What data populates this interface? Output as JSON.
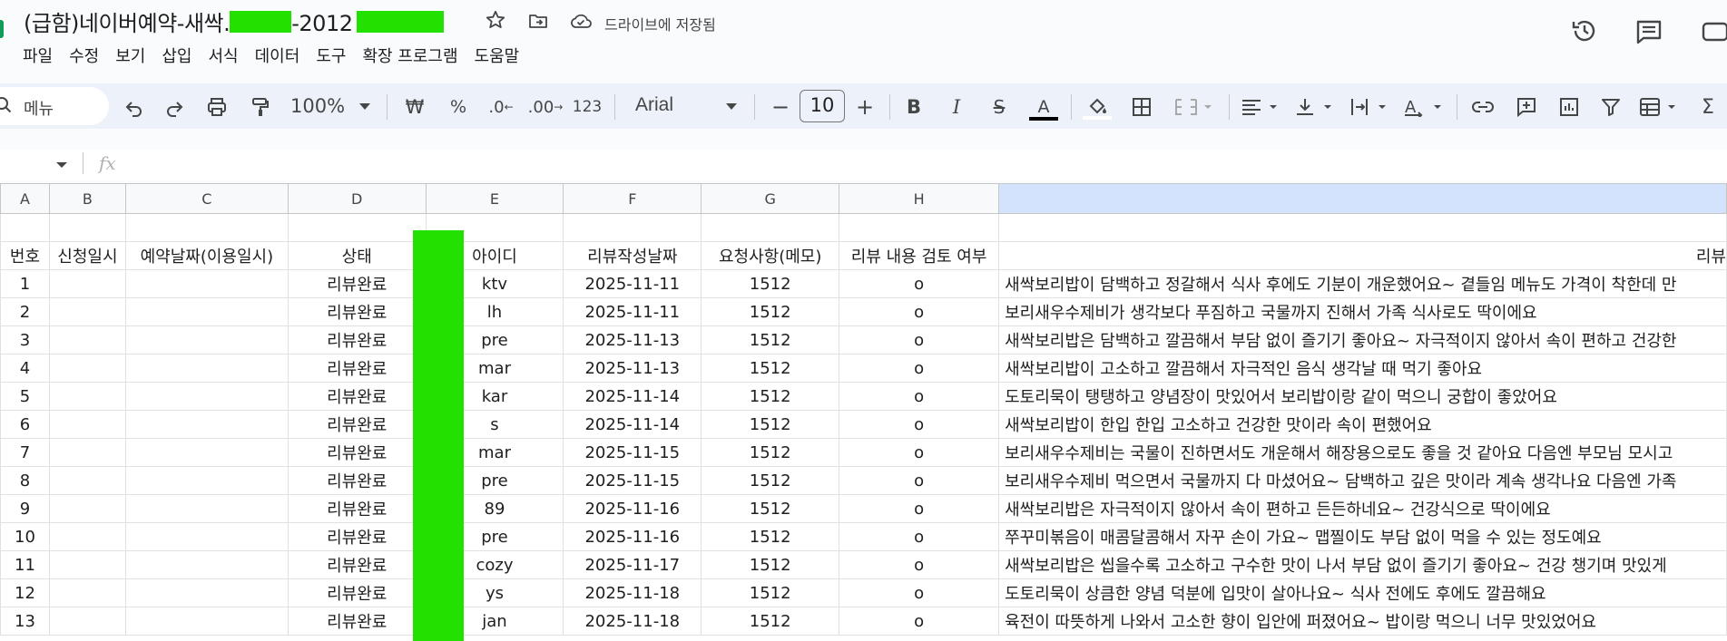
{
  "title": {
    "doc_title": "(급함)네이버예약-새싹.",
    "doc_title_suffix": "-2012",
    "save_status": "드라이브에 저장됨"
  },
  "menu": [
    "파일",
    "수정",
    "보기",
    "삽입",
    "서식",
    "데이터",
    "도구",
    "확장 프로그램",
    "도움말"
  ],
  "toolbar": {
    "search_label": "메뉴",
    "zoom": "100%",
    "currency": "₩",
    "percent": "%",
    "number_format": "123",
    "font": "Arial",
    "font_size": "10"
  },
  "formula_bar": {
    "fx": "fx"
  },
  "columns": [
    "A",
    "B",
    "C",
    "D",
    "E",
    "F",
    "G",
    "H",
    ""
  ],
  "header_row": [
    "번호",
    "신청일시",
    "예약날짜(이용일시)",
    "상태",
    "아이디",
    "리뷰작성날짜",
    "요청사항(메모)",
    "리뷰 내용 검토 여부",
    "리뷰"
  ],
  "rows": [
    {
      "no": "1",
      "status": "리뷰완료",
      "id": "ktv",
      "date": "2025-11-11",
      "memo": "1512",
      "check": "o",
      "review": "새싹보리밥이 담백하고 정갈해서 식사 후에도 기분이 개운했어요~ 곁들임 메뉴도 가격이 착한데 만"
    },
    {
      "no": "2",
      "status": "리뷰완료",
      "id": "lh",
      "date": "2025-11-11",
      "memo": "1512",
      "check": "o",
      "review": "보리새우수제비가 생각보다 푸짐하고 국물까지 진해서 가족 식사로도 딱이에요"
    },
    {
      "no": "3",
      "status": "리뷰완료",
      "id": "pre",
      "date": "2025-11-13",
      "memo": "1512",
      "check": "o",
      "review": "새싹보리밥은 담백하고 깔끔해서 부담 없이 즐기기 좋아요~ 자극적이지 않아서 속이 편하고 건강한"
    },
    {
      "no": "4",
      "status": "리뷰완료",
      "id": "mar",
      "date": "2025-11-13",
      "memo": "1512",
      "check": "o",
      "review": "새싹보리밥이 고소하고 깔끔해서 자극적인 음식 생각날 때 먹기 좋아요"
    },
    {
      "no": "5",
      "status": "리뷰완료",
      "id": "kar",
      "date": "2025-11-14",
      "memo": "1512",
      "check": "o",
      "review": "도토리묵이 탱탱하고 양념장이 맛있어서 보리밥이랑 같이 먹으니 궁합이 좋았어요"
    },
    {
      "no": "6",
      "status": "리뷰완료",
      "id": "s",
      "date": "2025-11-14",
      "memo": "1512",
      "check": "o",
      "review": "새싹보리밥이 한입 한입 고소하고 건강한 맛이라 속이 편했어요"
    },
    {
      "no": "7",
      "status": "리뷰완료",
      "id": "mar",
      "date": "2025-11-15",
      "memo": "1512",
      "check": "o",
      "review": "보리새우수제비는 국물이 진하면서도 개운해서 해장용으로도 좋을 것 같아요 다음엔 부모님 모시고"
    },
    {
      "no": "8",
      "status": "리뷰완료",
      "id": "pre",
      "date": "2025-11-15",
      "memo": "1512",
      "check": "o",
      "review": "보리새우수제비 먹으면서 국물까지 다 마셨어요~ 담백하고 깊은 맛이라 계속 생각나요 다음엔 가족"
    },
    {
      "no": "9",
      "status": "리뷰완료",
      "id": "89",
      "date": "2025-11-16",
      "memo": "1512",
      "check": "o",
      "review": "새싹보리밥은 자극적이지 않아서 속이 편하고 든든하네요~ 건강식으로 딱이에요"
    },
    {
      "no": "10",
      "status": "리뷰완료",
      "id": "pre",
      "date": "2025-11-16",
      "memo": "1512",
      "check": "o",
      "review": "쭈꾸미볶음이 매콤달콤해서 자꾸 손이 가요~ 맵찔이도 부담 없이 먹을 수 있는 정도예요"
    },
    {
      "no": "11",
      "status": "리뷰완료",
      "id": "cozy",
      "date": "2025-11-17",
      "memo": "1512",
      "check": "o",
      "review": "새싹보리밥은 씹을수록 고소하고 구수한 맛이 나서 부담 없이 즐기기 좋아요~ 건강 챙기며 맛있게"
    },
    {
      "no": "12",
      "status": "리뷰완료",
      "id": "ys",
      "date": "2025-11-18",
      "memo": "1512",
      "check": "o",
      "review": "도토리묵이 상큼한 양념 덕분에 입맛이 살아나요~ 식사 전에도 후에도 깔끔해요"
    },
    {
      "no": "13",
      "status": "리뷰완료",
      "id": "jan",
      "date": "2025-11-18",
      "memo": "1512",
      "check": "o",
      "review": "육전이 따뜻하게 나와서 고소한 향이 입안에 퍼졌어요~ 밥이랑 먹으니 너무 맛있었어요"
    }
  ],
  "colors": {
    "redaction": "#22e100",
    "toolbar_bg": "#edf2fa",
    "selected_col_header": "#d3e3fd"
  }
}
